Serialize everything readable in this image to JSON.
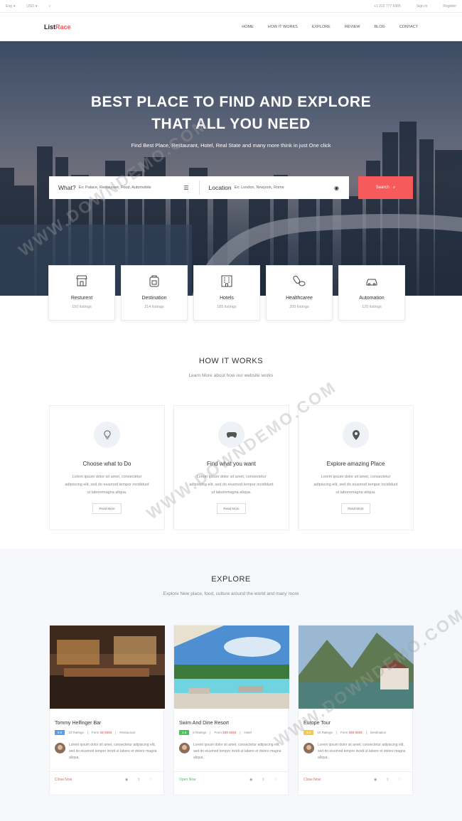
{
  "topbar": {
    "lang": "Eng",
    "currency": "USD",
    "phone": "+1 222 777 9365",
    "signin": "Sign In",
    "register": "Register"
  },
  "brand": {
    "part1": "List",
    "part2": "Race"
  },
  "nav": [
    "HOME",
    "HOW IT WORKS",
    "EXPLORE",
    "REVIEW",
    "BLOG",
    "CONTACT"
  ],
  "hero": {
    "title_line1": "BEST PLACE TO FIND AND EXPLORE",
    "title_line2": "THAT ALL YOU NEED",
    "subtitle": "Find Best Place, Restaurant, Hotel, Real State and many more think in just One click"
  },
  "search": {
    "what_label": "What?",
    "what_placeholder": "Ex: Palace, Restaurant, Food, Automobile",
    "location_label": "Location",
    "location_placeholder": "Ex: London, Newyork, Rome",
    "button": "Search"
  },
  "categories": [
    {
      "name": "Resturent",
      "count": "150 listings",
      "icon": "store-icon"
    },
    {
      "name": "Destination",
      "count": "214 listings",
      "icon": "backpack-icon"
    },
    {
      "name": "Hotels",
      "count": "185 listings",
      "icon": "hotel-icon"
    },
    {
      "name": "Healthcaree",
      "count": "200 listings",
      "icon": "pills-icon"
    },
    {
      "name": "Automation",
      "count": "120 listings",
      "icon": "car-icon"
    }
  ],
  "how": {
    "title": "HOW IT WORKS",
    "subtitle": "Learn More about how our website works",
    "steps": [
      {
        "title": "Choose what to Do",
        "desc": "Lorem ipsum dolor sit amet, consectetur adipiscing elit, sed do eiusmod tempor incididunt ut laboremagna aliqua.",
        "button": "Read More",
        "icon": "lightbulb-icon"
      },
      {
        "title": "Find what you want",
        "desc": "Lorem ipsum dolor sit amet, consectetur adipiscing elit, sed do eiusmod tempor incididunt ut laboremagna aliqua.",
        "button": "Read More",
        "icon": "gamepad-icon"
      },
      {
        "title": "Explore amazing Place",
        "desc": "Lorem ipsum dolor sit amet, consectetur adipiscing elit, sed do eiusmod tempor incididunt ut laboremagna aliqua.",
        "button": "Read More",
        "icon": "map-marker-icon"
      }
    ]
  },
  "explore": {
    "title": "EXPLORE",
    "subtitle": "Explore New place, food, culture around the world and many more",
    "cards": [
      {
        "title": "Tommy Helfinger Bar",
        "rating": "5.0",
        "rating_color": "#5a9be8",
        "ratings_text": "10 Ratings",
        "price_label": "Form",
        "price": "$$-$$$$",
        "category": "Restaurant",
        "desc": "Lorem ipsum dolor sit amet, consectetur adipiscing elit, sed do eiusmod tempor incidi ut labore et dolore magna aliqua.",
        "status": "Close Now",
        "status_color": "#f65a5a"
      },
      {
        "title": "Swim And Dine Resort",
        "rating": "4.5",
        "rating_color": "#4cc35a",
        "ratings_text": "8 Ratings",
        "price_label": "Form",
        "price": "$$$-$$$$",
        "category": "Hotel",
        "desc": "Lorem ipsum dolor sit amet, consectetur adipiscing elit, sed do eiusmod tempor incidi ut labore et dolore magna aliqua.",
        "status": "Open Now",
        "status_color": "#4cc35a"
      },
      {
        "title": "Europe Tour",
        "rating": "3.0",
        "rating_color": "#f2c94c",
        "ratings_text": "10 Ratings",
        "price_label": "Form",
        "price": "$$$-$$$$",
        "category": "Destination",
        "desc": "Lorem ipsum dolor sit amet, consectetur adipiscing elit, sed do eiusmod tempor incidi ut labore et dolore magna aliqua.",
        "status": "Close Now",
        "status_color": "#f65a5a"
      }
    ]
  },
  "watermark": "WWW.DOWNDEMO.COM"
}
